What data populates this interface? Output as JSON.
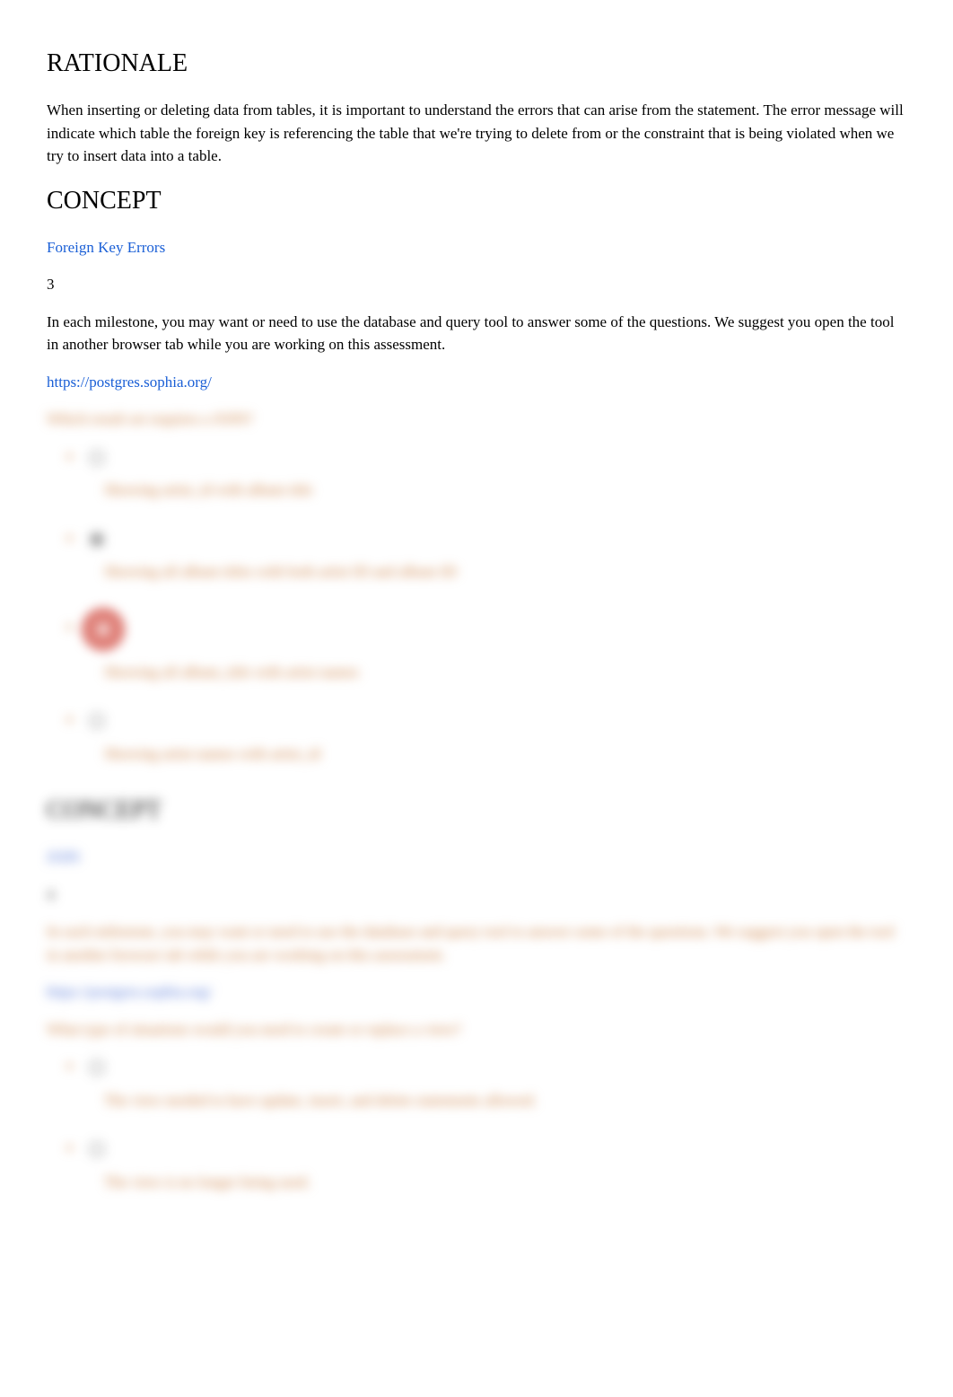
{
  "section1": {
    "rationale_heading": "RATIONALE",
    "rationale_body": "When inserting or deleting data from tables, it is important to understand the errors that can arise from the statement. The error message will indicate which table the foreign key is referencing the table that we're trying to delete from or the constraint that is being violated when we try to insert data into a table.",
    "concept_heading": "CONCEPT",
    "concept_link": "Foreign Key Errors",
    "question_number": "3",
    "intro": "In each milestone, you may want or need to use the database and query tool to answer some of the questions. We suggest you open the tool in another browser tab while you are working on this assessment.",
    "tool_url": "https://postgres.sophia.org/"
  },
  "blurred1": {
    "question": "Which result set requires a JOIN?",
    "options": [
      "Showing artist_id with album title",
      "Showing all album titles with both artist ID and album ID",
      "Showing all album_title with artist names",
      "Showing artist names with artist_id"
    ],
    "concept_heading": "CONCEPT",
    "concept_link": "JOIN",
    "question_number": "4",
    "intro": "In each milestone, you may want or need to use the database and query tool to answer some of the questions. We suggest you open the tool in another browser tab while you are working on this assessment.",
    "tool_url": "https://postgres.sophia.org/",
    "question2": "What type of situations would you need to create or replace a view?",
    "options2": [
      "The view needed to have update, insert, and delete statements allowed.",
      "The view is no longer being used."
    ]
  }
}
